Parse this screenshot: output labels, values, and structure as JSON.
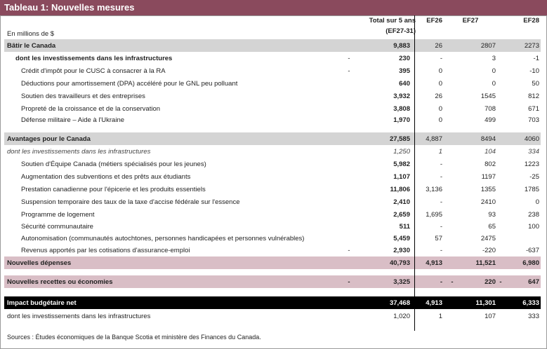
{
  "title": "Tableau 1: Nouvelles mesures",
  "header": {
    "unit_label": "En millions de $",
    "total_line1": "Total sur 5 ans",
    "total_line2": "(EF27-31)",
    "ef26": "EF26",
    "ef27": "EF27",
    "ef28": "EF28"
  },
  "rows": [
    {
      "label": "Bâtir le Canada",
      "dash": "",
      "total": "9,883",
      "ef26": "26",
      "mid": "",
      "ef27": "2807",
      "mid2": "",
      "ef28": "2273"
    },
    {
      "label": "dont les investissements dans les infrastructures",
      "dash": "-",
      "total": "230",
      "ef26": "-",
      "mid": "",
      "ef27": "3",
      "mid2": "",
      "ef28": "-1"
    },
    {
      "label": "Crédit d'impôt pour le CUSC à consacrer à la RA",
      "dash": "-",
      "total": "395",
      "ef26": "0",
      "mid": "",
      "ef27": "0",
      "mid2": "",
      "ef28": "-10"
    },
    {
      "label": "Déductions pour amortissement (DPA) accéléré pour le GNL peu polluant",
      "dash": "",
      "total": "640",
      "ef26": "0",
      "mid": "",
      "ef27": "0",
      "mid2": "",
      "ef28": "50"
    },
    {
      "label": "Soutien des travailleurs et des entreprises",
      "dash": "",
      "total": "3,932",
      "ef26": "26",
      "mid": "",
      "ef27": "1545",
      "mid2": "",
      "ef28": "812"
    },
    {
      "label": "Propreté de la croissance et de la conservation",
      "dash": "",
      "total": "3,808",
      "ef26": "0",
      "mid": "",
      "ef27": "708",
      "mid2": "",
      "ef28": "671"
    },
    {
      "label": "Défense militaire – Aide à l'Ukraine",
      "dash": "",
      "total": "1,970",
      "ef26": "0",
      "mid": "",
      "ef27": "499",
      "mid2": "",
      "ef28": "703"
    },
    {
      "label": "Avantages pour le Canada",
      "dash": "",
      "total": "27,585",
      "ef26": "4,887",
      "mid": "",
      "ef27": "8494",
      "mid2": "",
      "ef28": "4060"
    },
    {
      "label": "dont les investissements dans les infrastructures",
      "dash": "",
      "total": "1,250",
      "ef26": "1",
      "mid": "",
      "ef27": "104",
      "mid2": "",
      "ef28": "334"
    },
    {
      "label": "Soutien d'Équipe Canada (métiers spécialisés pour les jeunes)",
      "dash": "",
      "total": "5,982",
      "ef26": "-",
      "mid": "",
      "ef27": "802",
      "mid2": "",
      "ef28": "1223"
    },
    {
      "label": "Augmentation des subventions et des prêts aux étudiants",
      "dash": "",
      "total": "1,107",
      "ef26": "-",
      "mid": "",
      "ef27": "1197",
      "mid2": "",
      "ef28": "-25"
    },
    {
      "label": "Prestation canadienne pour l'épicerie et les produits essentiels",
      "dash": "",
      "total": "11,806",
      "ef26": "3,136",
      "mid": "",
      "ef27": "1355",
      "mid2": "",
      "ef28": "1785"
    },
    {
      "label": "Suspension temporaire des taux de la taxe d'accise fédérale sur l'essence",
      "dash": "",
      "total": "2,410",
      "ef26": "-",
      "mid": "",
      "ef27": "2410",
      "mid2": "",
      "ef28": "0"
    },
    {
      "label": "Programme de logement",
      "dash": "",
      "total": "2,659",
      "ef26": "1,695",
      "mid": "",
      "ef27": "93",
      "mid2": "",
      "ef28": "238"
    },
    {
      "label": "Sécurité communautaire",
      "dash": "",
      "total": "511",
      "ef26": "-",
      "mid": "",
      "ef27": "65",
      "mid2": "",
      "ef28": "100"
    },
    {
      "label": "Autonomisation (communautés autochtones, personnes handicapées et personnes vulnérables)",
      "dash": "",
      "total": "5,459",
      "ef26": "57",
      "mid": "",
      "ef27": "2475",
      "mid2": "",
      "ef28": ""
    },
    {
      "label": "Revenus apportés par les cotisations d'assurance-emploi",
      "dash": "-",
      "total": "2,930",
      "ef26": "-",
      "mid": "",
      "ef27": "-220",
      "mid2": "",
      "ef28": "-637"
    },
    {
      "label": "Nouvelles dépenses",
      "dash": "",
      "total": "40,793",
      "ef26": "4,913",
      "mid": "",
      "ef27": "11,521",
      "mid2": "",
      "ef28": "6,980"
    },
    {
      "label": "Nouvelles recettes ou économies",
      "dash": "-",
      "total": "3,325",
      "ef26": "-",
      "mid": "-",
      "ef27": "220",
      "mid2": "-",
      "ef28": "647"
    },
    {
      "label": "Impact budgétaire net",
      "dash": "",
      "total": "37,468",
      "ef26": "4,913",
      "mid": "",
      "ef27": "11,301",
      "mid2": "",
      "ef28": "6,333"
    },
    {
      "label": "dont les investissements dans les infrastructures",
      "dash": "",
      "total": "1,020",
      "ef26": "1",
      "mid": "",
      "ef27": "107",
      "mid2": "",
      "ef28": "333"
    }
  ],
  "source": "Sources : Études économiques de la Banque Scotia et ministère des Finances du Canada."
}
